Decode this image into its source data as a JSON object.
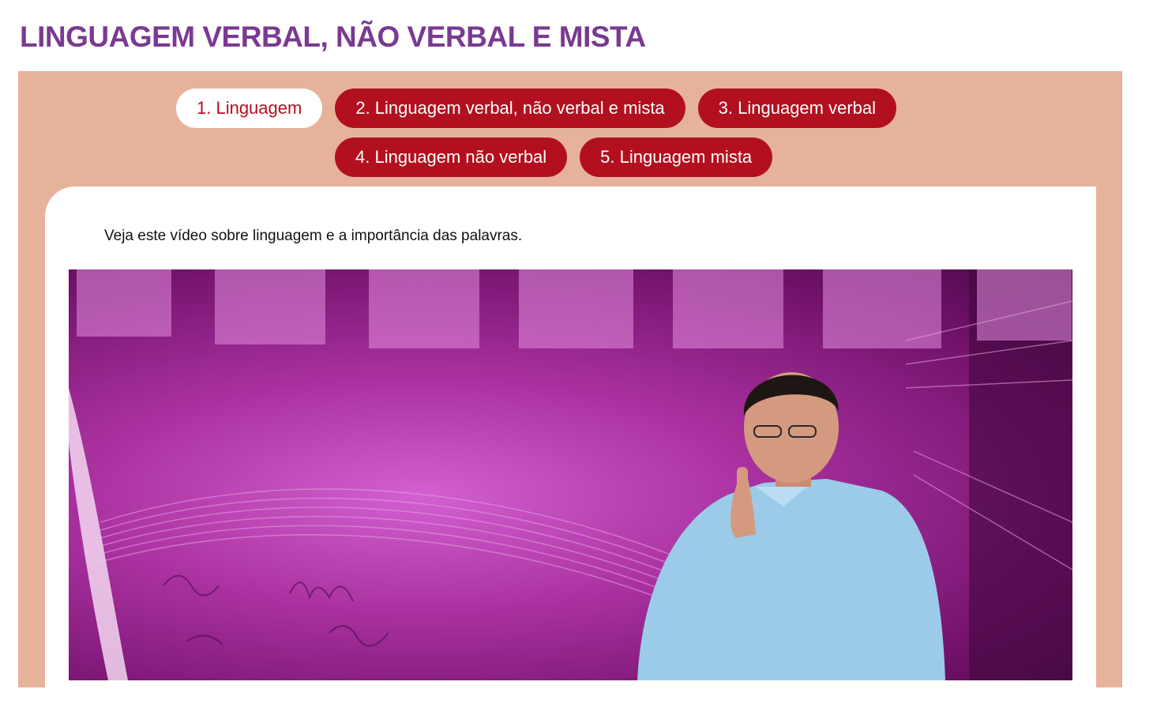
{
  "page": {
    "title": "LINGUAGEM VERBAL, NÃO VERBAL E MISTA"
  },
  "tabs": [
    {
      "label": "1. Linguagem",
      "active": true
    },
    {
      "label": "2. Linguagem verbal, não verbal e mista",
      "active": false
    },
    {
      "label": "3. Linguagem verbal",
      "active": false
    },
    {
      "label": "4. Linguagem não verbal",
      "active": false
    },
    {
      "label": "5. Linguagem mista",
      "active": false
    }
  ],
  "content": {
    "intro": "Veja este vídeo sobre linguagem e a importância das palavras."
  },
  "colors": {
    "title": "#7a3a91",
    "panel": "#e6b39a",
    "tab": "#b3101f",
    "tab_active_bg": "#ffffff"
  }
}
